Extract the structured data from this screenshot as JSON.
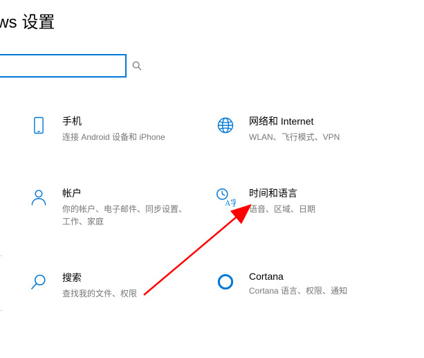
{
  "title": "ows 设置",
  "search": {
    "placeholder": ""
  },
  "items": [
    {
      "title": "手机",
      "desc": "连接 Android 设备和 iPhone"
    },
    {
      "title": "网络和 Internet",
      "desc": "WLAN、飞行模式、VPN"
    },
    {
      "title": "帐户",
      "desc": "你的帐户、电子邮件、同步设置、工作、家庭"
    },
    {
      "title": "时间和语言",
      "desc": "语音、区域、日期"
    },
    {
      "title": "搜索",
      "desc": "查找我的文件、权限"
    },
    {
      "title": "Cortana",
      "desc": "Cortana 语言、权限、通知"
    }
  ]
}
